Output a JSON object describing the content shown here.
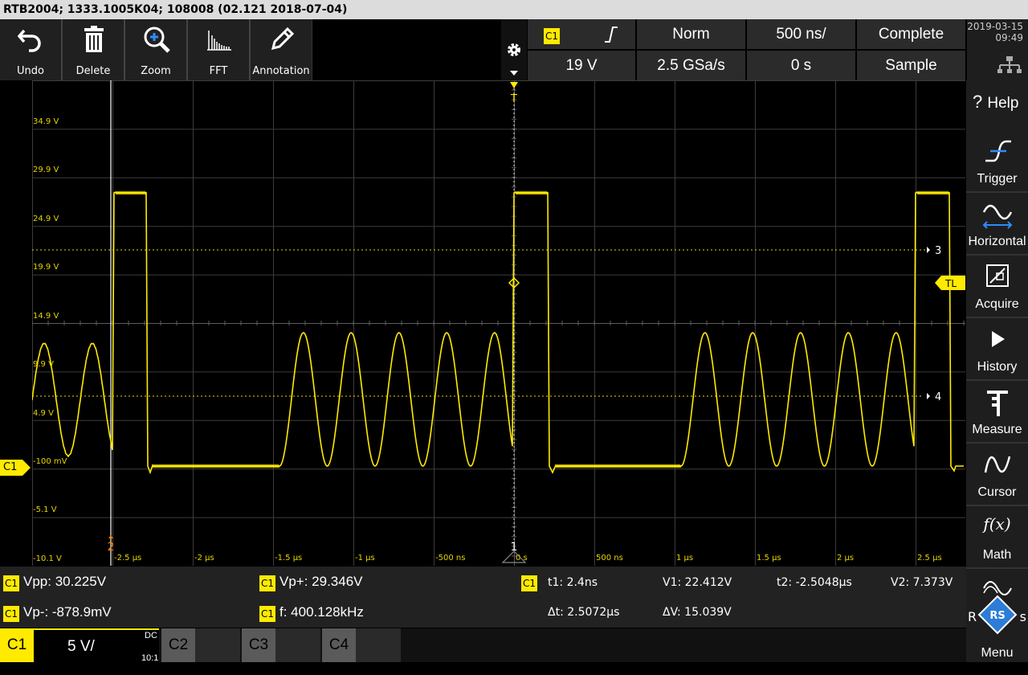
{
  "titlebar": {
    "text": "RTB2004; 1333.1005K04; 108008 (02.121 2018-07-04)"
  },
  "toolbar": {
    "undo": "Undo",
    "delete": "Delete",
    "zoom": "Zoom",
    "fft": "FFT",
    "annotation": "Annotation"
  },
  "topinfo": {
    "channel": "C1",
    "level": "19 V",
    "mode": "Norm",
    "samplerate": "2.5 GSa/s",
    "timebase": "500 ns/",
    "position": "0 s",
    "acq": "Complete",
    "acqmode": "Sample",
    "date": "2019-03-15",
    "time": "09:49"
  },
  "rightmenu": {
    "help": "Help",
    "trigger": "Trigger",
    "horizontal": "Horizontal",
    "acquire": "Acquire",
    "history": "History",
    "measure": "Measure",
    "cursor": "Cursor",
    "math": "Math",
    "ref": "R",
    "ref2": "s",
    "menu": "Menu",
    "help_icon": "?",
    "fx": "f(x)"
  },
  "scope": {
    "ylabels": [
      "34.9 V",
      "29.9 V",
      "24.9 V",
      "19.9 V",
      "14.9 V",
      "9.9 V",
      "4.9 V",
      "-100 mV",
      "-5.1 V",
      "-10.1 V"
    ],
    "xlabels": [
      "-2.5 µs",
      "-2 µs",
      "-1.5 µs",
      "-1 µs",
      "-500 ns",
      "0 s",
      "500 ns",
      "1 µs",
      "1.5 µs",
      "2 µs",
      "2.5 µs"
    ],
    "cursor3": "3",
    "cursor4": "4",
    "cursor2": "2",
    "cursor1": "1",
    "tl": "TL",
    "ch_marker": "C1",
    "trig_marker": "T"
  },
  "measurements": {
    "c1": "C1",
    "vpp": "Vpp: 30.225V",
    "vpplus": "Vp+: 29.346V",
    "vpminus": "Vp-: -878.9mV",
    "freq": "f: 400.128kHz",
    "t1": "t1: 2.4ns",
    "v1": "V1: 22.412V",
    "t2": "t2: -2.5048µs",
    "v2": "V2: 7.373V",
    "dt": "Δt: 2.5072µs",
    "dv": "ΔV: 15.039V"
  },
  "channels": {
    "c1": "C1",
    "c1scale": "5 V/",
    "c1coupling": "DC",
    "c1probe": "10:1",
    "c2": "C2",
    "c3": "C3",
    "c4": "C4"
  },
  "colors": {
    "ch1": "#ffea00",
    "cursor": "#ff7f00"
  }
}
